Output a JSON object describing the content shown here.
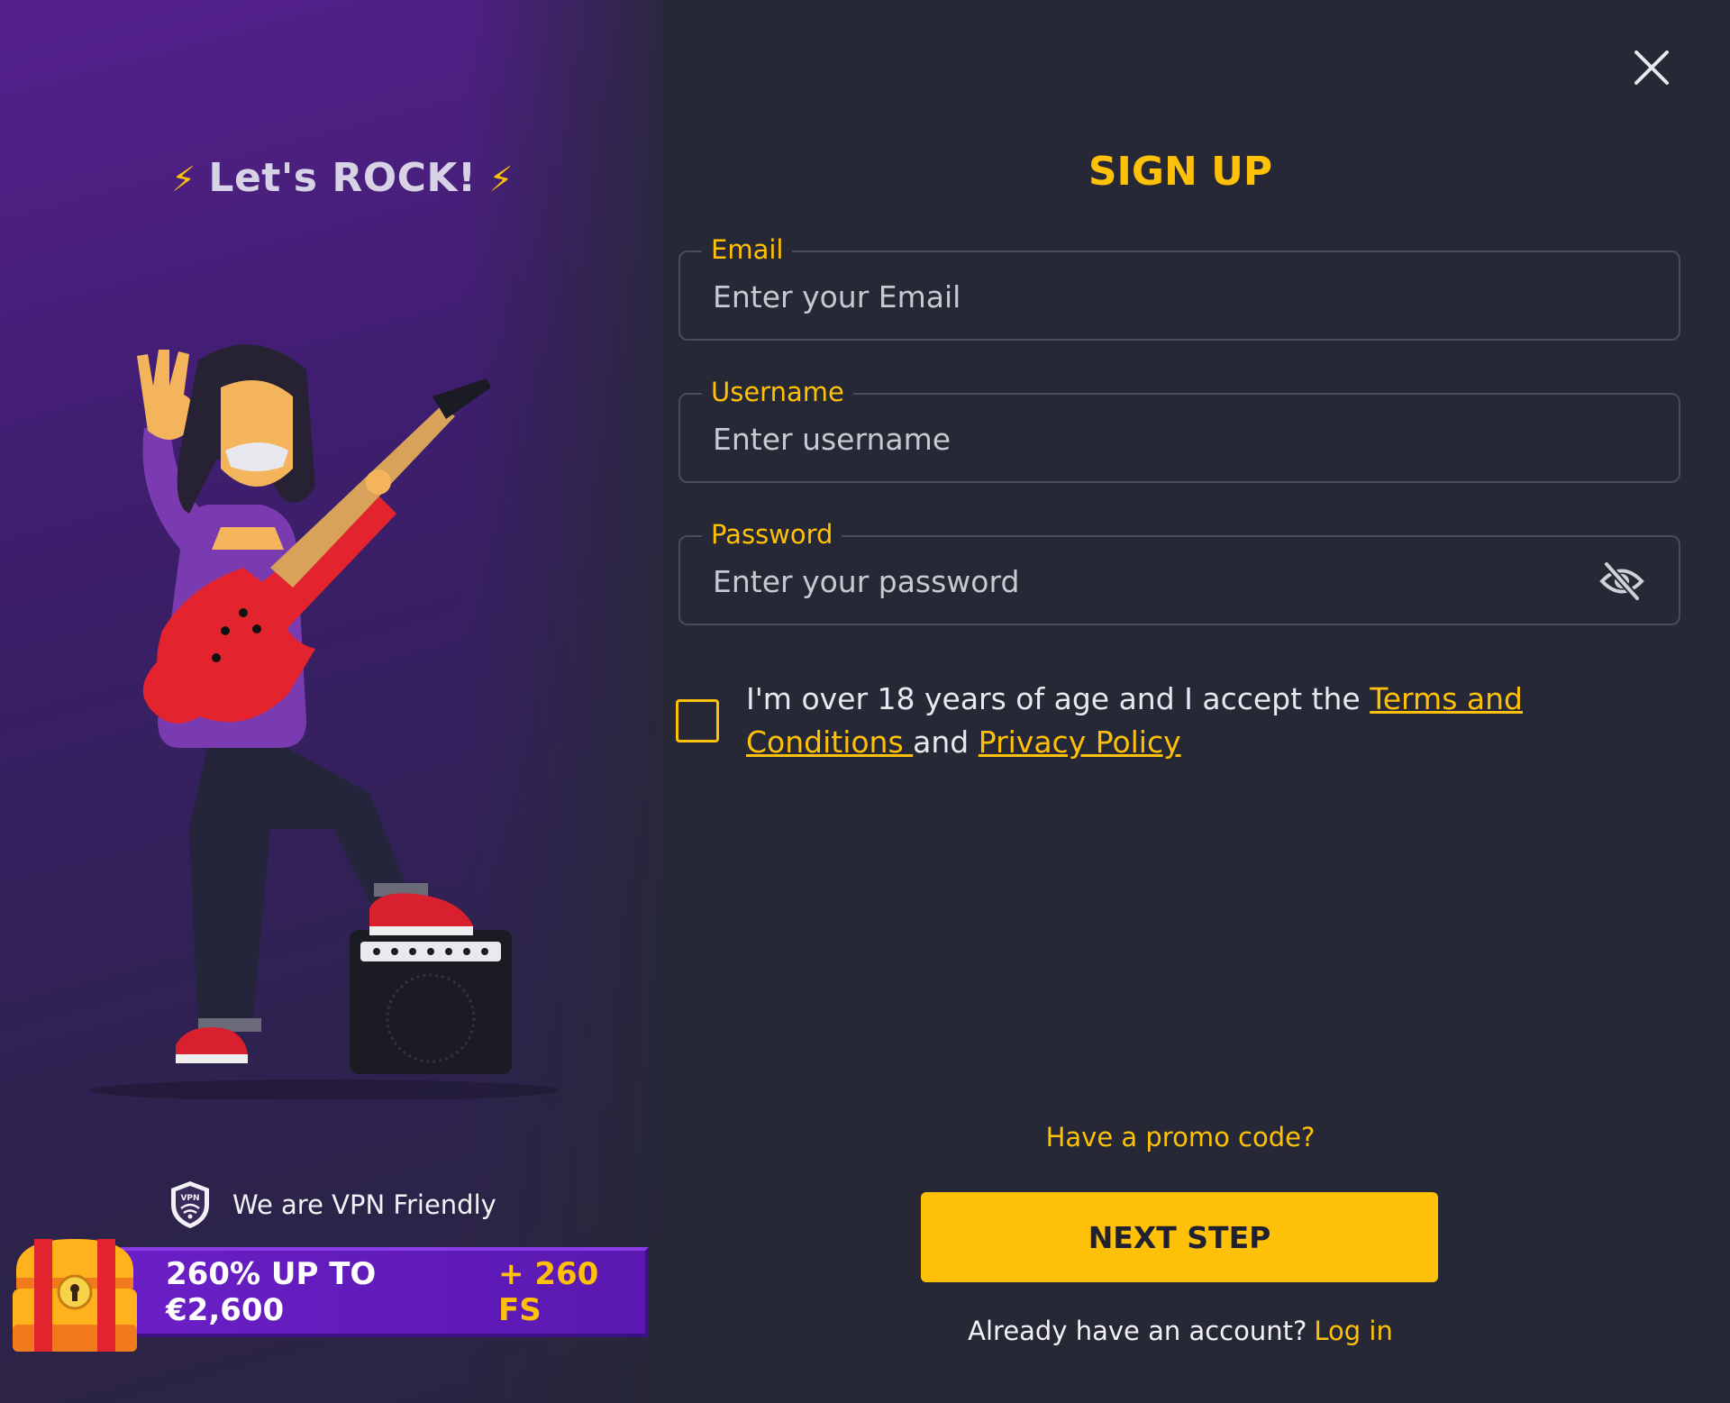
{
  "left": {
    "headline": "Let's ROCK!",
    "bolt": "⚡",
    "vpn_text": "We are VPN Friendly",
    "vpn_badge": "VPN",
    "bonus_main": "260% UP TO €2,600",
    "bonus_extra": "+ 260 FS"
  },
  "form": {
    "title": "SIGN UP",
    "email": {
      "label": "Email",
      "placeholder": "Enter your Email",
      "value": ""
    },
    "username": {
      "label": "Username",
      "placeholder": "Enter username",
      "value": ""
    },
    "password": {
      "label": "Password",
      "placeholder": "Enter your password",
      "value": "",
      "toggle_icon": "eye-off-icon"
    },
    "terms": {
      "prefix": "I'm over 18 years of age and I accept the ",
      "terms_link": "Terms and Conditions ",
      "middle": "and ",
      "privacy_link": "Privacy Policy",
      "checked": false
    },
    "promo_link": "Have a promo code?",
    "next_button": "NEXT STEP",
    "login_prompt": "Already have an account?",
    "login_link": "Log in"
  },
  "colors": {
    "accent": "#ffc107",
    "background": "#262836",
    "panel_purple": "#55208d",
    "banner_purple": "#6a1fc6"
  }
}
